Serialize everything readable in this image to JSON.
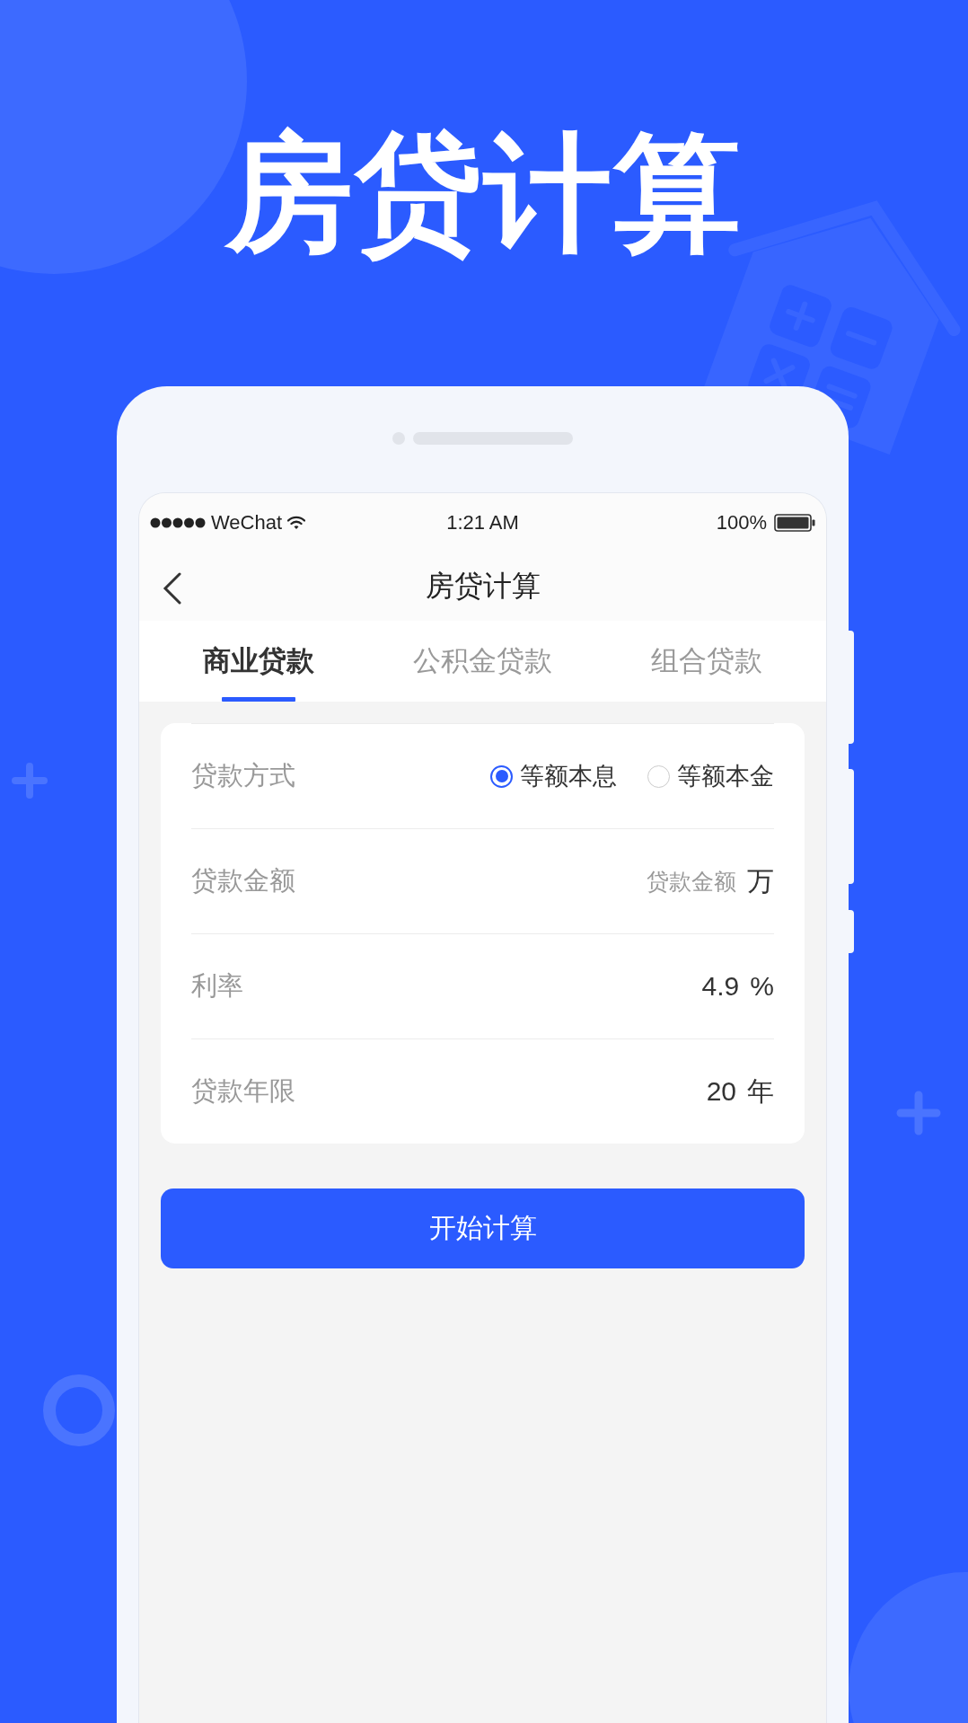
{
  "headline": "房贷计算",
  "status_bar": {
    "carrier": "WeChat",
    "time": "1:21 AM",
    "battery": "100%"
  },
  "nav": {
    "title": "房贷计算"
  },
  "tabs": [
    {
      "label": "商业贷款",
      "selected": true
    },
    {
      "label": "公积金贷款",
      "selected": false
    },
    {
      "label": "组合贷款",
      "selected": false
    }
  ],
  "form": [
    {
      "kind": "radio",
      "label": "贷款方式",
      "options": [
        {
          "label": "等额本息",
          "selected": true
        },
        {
          "label": "等额本金",
          "selected": false
        }
      ]
    },
    {
      "kind": "input",
      "label": "贷款金额",
      "placeholder": "贷款金额",
      "unit": "万"
    },
    {
      "kind": "value",
      "label": "利率",
      "value": "4.9",
      "unit": "%"
    },
    {
      "kind": "value",
      "label": "贷款年限",
      "value": "20",
      "unit": "年"
    }
  ],
  "button": {
    "label": "开始计算"
  }
}
